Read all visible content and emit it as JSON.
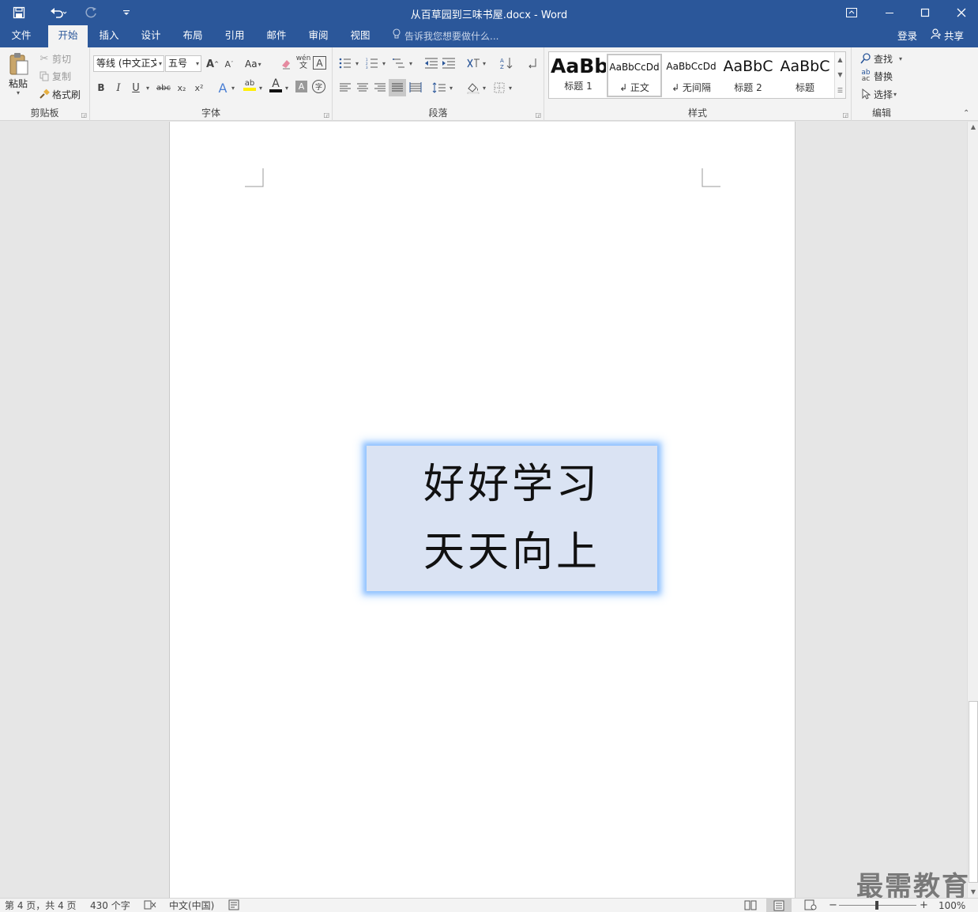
{
  "window": {
    "title": "从百草园到三味书屋.docx - Word",
    "controls": [
      "ribbon-display",
      "minimize",
      "maximize",
      "close"
    ]
  },
  "quick_access": {
    "icons": [
      "save-icon",
      "undo-icon",
      "redo-icon",
      "customize-icon"
    ]
  },
  "tabs": [
    {
      "label": "文件"
    },
    {
      "label": "开始"
    },
    {
      "label": "插入"
    },
    {
      "label": "设计"
    },
    {
      "label": "布局"
    },
    {
      "label": "引用"
    },
    {
      "label": "邮件"
    },
    {
      "label": "审阅"
    },
    {
      "label": "视图"
    }
  ],
  "active_tab": "开始",
  "tell_me": "告诉我您想要做什么...",
  "account": {
    "login": "登录",
    "share": "共享"
  },
  "ribbon": {
    "clipboard": {
      "label": "剪贴板",
      "paste": "粘贴",
      "cut": "剪切",
      "copy": "复制",
      "format_painter": "格式刷"
    },
    "font": {
      "label": "字体",
      "font_name": "等线 (中文正文",
      "font_size": "五号",
      "aa_button": "Aa",
      "bold": "B",
      "italic": "I",
      "underline": "U",
      "strike": "abc",
      "subscript": "x₂",
      "superscript": "x²",
      "phonetic": "wén",
      "phonetic_sub": "文",
      "char_border": "A",
      "char_shading": "A",
      "enclosed": "字",
      "font_color": "A",
      "text_effects": "A",
      "highlight": "ab"
    },
    "paragraph": {
      "label": "段落"
    },
    "styles": {
      "label": "样式",
      "items": [
        {
          "preview": "AaBb",
          "name": "标题 1"
        },
        {
          "preview": "AaBbCcDd",
          "name": "↲ 正文"
        },
        {
          "preview": "AaBbCcDd",
          "name": "↲ 无间隔"
        },
        {
          "preview": "AaBbC",
          "name": "标题 2"
        },
        {
          "preview": "AaBbC",
          "name": "标题"
        }
      ]
    },
    "editing": {
      "label": "编辑",
      "find": "查找",
      "replace": "替换",
      "select": "选择"
    }
  },
  "document": {
    "textbox_lines": [
      "好好学习",
      "天天向上"
    ],
    "textbox_fill": "#dae3f3",
    "glow_color": "#8cc4ff"
  },
  "statusbar": {
    "page": "第 4 页，共 4 页",
    "words": "430 个字",
    "language": "中文(中国)",
    "zoom": "100%"
  },
  "watermark": "最需教育",
  "colors": {
    "accent": "#2b579a",
    "ribbon_bg": "#f3f3f3"
  }
}
